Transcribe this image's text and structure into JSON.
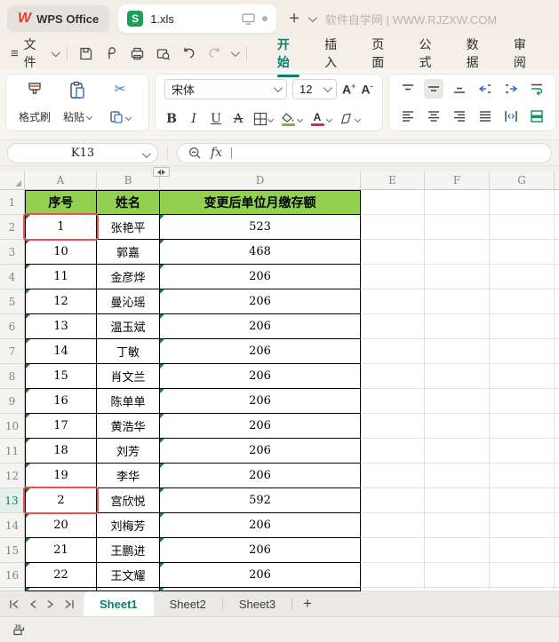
{
  "titlebar": {
    "app_name": "WPS Office",
    "logo_letter": "W",
    "doc_name": "1.xls",
    "doc_icon_letter": "S",
    "new_tab_label": "+",
    "site_label": "软件自学网 | WWW.RJZXW.COM"
  },
  "menubar": {
    "file_label": "文件",
    "hamburger": "≡",
    "tabs": [
      "开始",
      "插入",
      "页面",
      "公式",
      "数据",
      "审阅"
    ],
    "active_tab": "开始"
  },
  "ribbon": {
    "format_painter_label": "格式刷",
    "paste_label": "粘贴",
    "font_name": "宋体",
    "font_size": "12",
    "inc_font_label": "A",
    "inc_font_sign": "+",
    "dec_font_label": "A",
    "dec_font_sign": "-",
    "bold": "B",
    "italic": "I",
    "underline": "U",
    "strike_letter": "A",
    "font_color_letter": "A"
  },
  "formula_bar": {
    "name_box_value": "K13",
    "fx_label": "fx"
  },
  "sheet": {
    "col_headers": [
      "A",
      "B",
      "D",
      "E",
      "F",
      "G"
    ],
    "header_row": [
      "序号",
      "姓名",
      "变更后单位月缴存额"
    ],
    "data_rows": [
      [
        "1",
        "张艳平",
        "523"
      ],
      [
        "10",
        "郭嘉",
        "468"
      ],
      [
        "11",
        "金彦烨",
        "206"
      ],
      [
        "12",
        "曼沁瑶",
        "206"
      ],
      [
        "13",
        "温玉斌",
        "206"
      ],
      [
        "14",
        "丁敏",
        "206"
      ],
      [
        "15",
        "肖文兰",
        "206"
      ],
      [
        "16",
        "陈单单",
        "206"
      ],
      [
        "17",
        "黄浩华",
        "206"
      ],
      [
        "18",
        "刘芳",
        "206"
      ],
      [
        "19",
        "李华",
        "206"
      ],
      [
        "2",
        "宫欣悦",
        "592"
      ],
      [
        "20",
        "刘梅芳",
        "206"
      ],
      [
        "21",
        "王鹏进",
        "206"
      ],
      [
        "22",
        "王文耀",
        "206"
      ]
    ],
    "highlighted_cells": [
      "A2",
      "A13"
    ],
    "selected_row": 13,
    "header_fill": "#92d050",
    "highlight_border": "#ec5050"
  },
  "sheetbar": {
    "tabs": [
      "Sheet1",
      "Sheet2",
      "Sheet3"
    ],
    "active_tab": "Sheet1",
    "add_label": "+"
  },
  "colors": {
    "accent_teal": "#0e7c6e",
    "logo_red": "#e23c2b",
    "doc_icon_green": "#1d9f57",
    "error_triangle_green": "#1e7d34"
  }
}
